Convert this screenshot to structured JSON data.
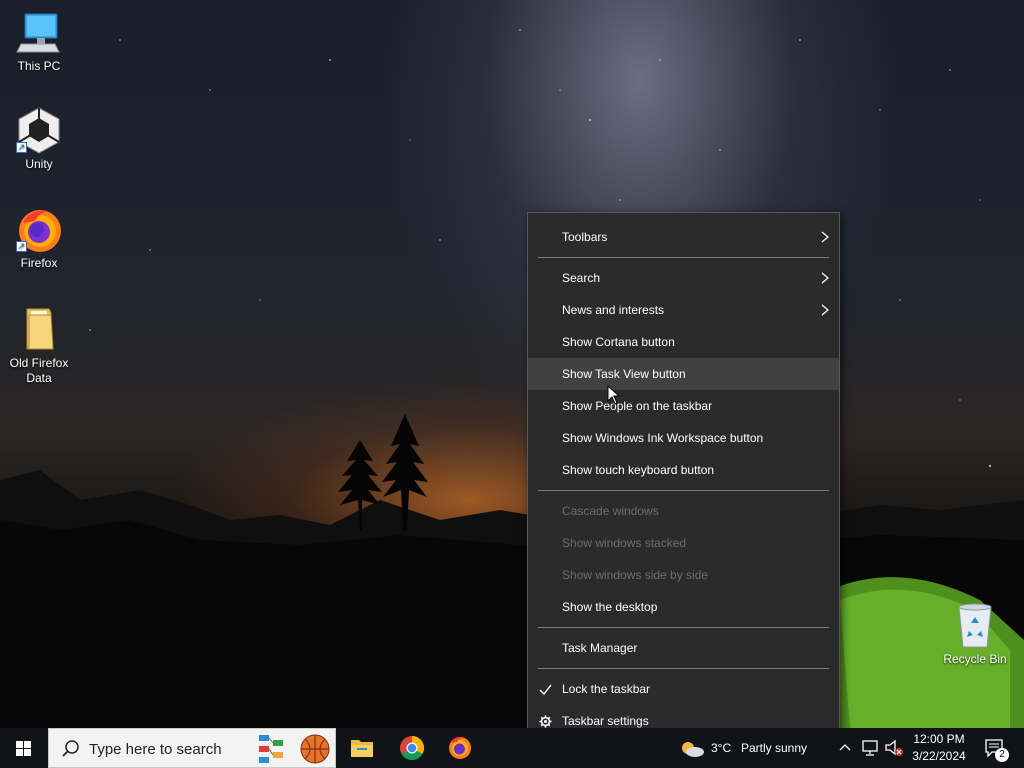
{
  "desktop": {
    "icons": [
      {
        "label": "This PC",
        "icon": "computer-icon"
      },
      {
        "label": "Unity",
        "icon": "unity-icon"
      },
      {
        "label": "Firefox",
        "icon": "firefox-icon"
      },
      {
        "label": "Old Firefox Data",
        "icon": "folder-icon"
      },
      {
        "label": "Recycle Bin",
        "icon": "recycle-bin-icon"
      }
    ]
  },
  "context_menu": {
    "items": [
      {
        "label": "Toolbars",
        "submenu": true,
        "enabled": true
      },
      {
        "label": "Search",
        "submenu": true,
        "enabled": true
      },
      {
        "label": "News and interests",
        "submenu": true,
        "enabled": true
      },
      {
        "label": "Show Cortana button",
        "enabled": true
      },
      {
        "label": "Show Task View button",
        "enabled": true,
        "hovered": true
      },
      {
        "label": "Show People on the taskbar",
        "enabled": true
      },
      {
        "label": "Show Windows Ink Workspace button",
        "enabled": true
      },
      {
        "label": "Show touch keyboard button",
        "enabled": true
      },
      {
        "label": "Cascade windows",
        "enabled": false
      },
      {
        "label": "Show windows stacked",
        "enabled": false
      },
      {
        "label": "Show windows side by side",
        "enabled": false
      },
      {
        "label": "Show the desktop",
        "enabled": true
      },
      {
        "label": "Task Manager",
        "enabled": true
      },
      {
        "label": "Lock the taskbar",
        "enabled": true,
        "checked": true
      },
      {
        "label": "Taskbar settings",
        "enabled": true,
        "icon": "gear-icon"
      }
    ]
  },
  "taskbar": {
    "search_placeholder": "Type here to search",
    "pinned_apps": [
      "file-explorer-icon",
      "chrome-icon",
      "firefox-icon"
    ],
    "weather": {
      "temp": "3°C",
      "condition": "Partly sunny"
    },
    "clock": {
      "time": "12:00 PM",
      "date": "3/22/2024"
    },
    "notification_count": "2"
  },
  "colors": {
    "menu_bg": "#2b2b2b",
    "menu_hover": "#414141",
    "menu_disabled_text": "#6d6d6d",
    "taskbar_bg": "#101419",
    "accent": "#0078d7"
  }
}
